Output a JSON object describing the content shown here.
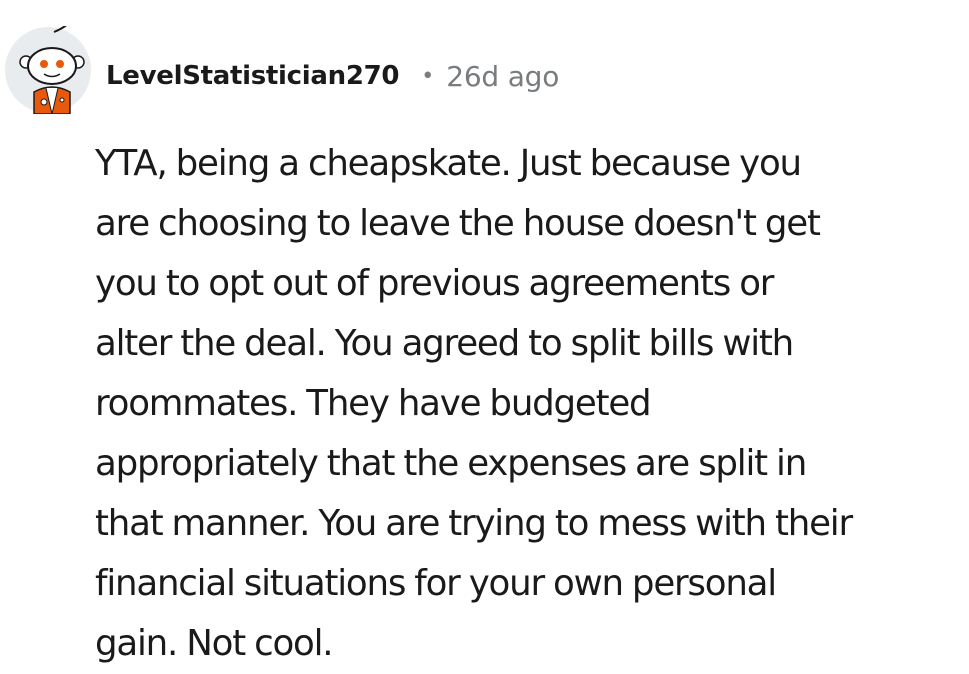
{
  "comment": {
    "author": "LevelStatistician270",
    "separator": "•",
    "timestamp": "26d ago",
    "avatar_icon": "snoo-avatar-icon",
    "body_lines": [
      "YTA, being a cheapskate. Just because you",
      "are choosing to leave the house doesn't get",
      "you to opt out of previous agreements or",
      "alter the deal. You agreed to split bills with",
      "roommates. They have budgeted",
      "appropriately that the expenses are split in",
      "that manner. You are trying to mess with their",
      "financial situations for your own personal",
      "gain. Not cool."
    ]
  },
  "colors": {
    "text": "#1a1a1b",
    "meta": "#787c7e",
    "avatar_bg": "#e9ecef",
    "avatar_accent": "#e8590c"
  }
}
